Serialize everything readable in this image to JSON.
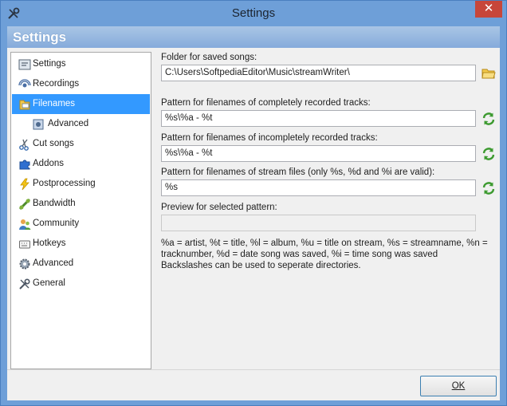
{
  "window": {
    "title": "Settings",
    "close_glyph": "✕"
  },
  "header": {
    "title": "Settings"
  },
  "nav": {
    "items": [
      {
        "label": "Settings",
        "icon": "settings-icon"
      },
      {
        "label": "Recordings",
        "icon": "recordings-icon"
      },
      {
        "label": "Filenames",
        "icon": "filenames-icon",
        "selected": true
      },
      {
        "label": "Advanced",
        "icon": "advanced-filenames-icon",
        "indent": true
      },
      {
        "label": "Cut songs",
        "icon": "scissors-icon"
      },
      {
        "label": "Addons",
        "icon": "puzzle-icon"
      },
      {
        "label": "Postprocessing",
        "icon": "lightning-icon"
      },
      {
        "label": "Bandwidth",
        "icon": "bandwidth-icon"
      },
      {
        "label": "Community",
        "icon": "community-icon"
      },
      {
        "label": "Hotkeys",
        "icon": "keyboard-icon"
      },
      {
        "label": "Advanced",
        "icon": "gear-icon"
      },
      {
        "label": "General",
        "icon": "tools-icon"
      }
    ]
  },
  "main": {
    "folder": {
      "label": "Folder for saved songs:",
      "value": "C:\\Users\\SoftpediaEditor\\Music\\streamWriter\\"
    },
    "pattern_complete": {
      "label": "Pattern for filenames of completely recorded tracks:",
      "value": "%s\\%a - %t"
    },
    "pattern_incomplete": {
      "label": "Pattern for filenames of incompletely recorded tracks:",
      "value": "%s\\%a - %t"
    },
    "pattern_stream": {
      "label": "Pattern for filenames of stream files (only %s, %d and %i are valid):",
      "value": "%s"
    },
    "preview": {
      "label": "Preview for selected pattern:",
      "value": ""
    },
    "help_line1": "%a = artist, %t = title, %l = album, %u = title on stream, %s = streamname, %n = tracknumber, %d = date song was saved, %i = time song was saved",
    "help_line2": "Backslashes can be used to seperate directories."
  },
  "footer": {
    "ok_label": "OK"
  },
  "colors": {
    "title_bar": "#6e9fd8",
    "header_gradient_top": "#a9c5e5",
    "selection": "#3399ff",
    "close_button": "#c7463a"
  }
}
